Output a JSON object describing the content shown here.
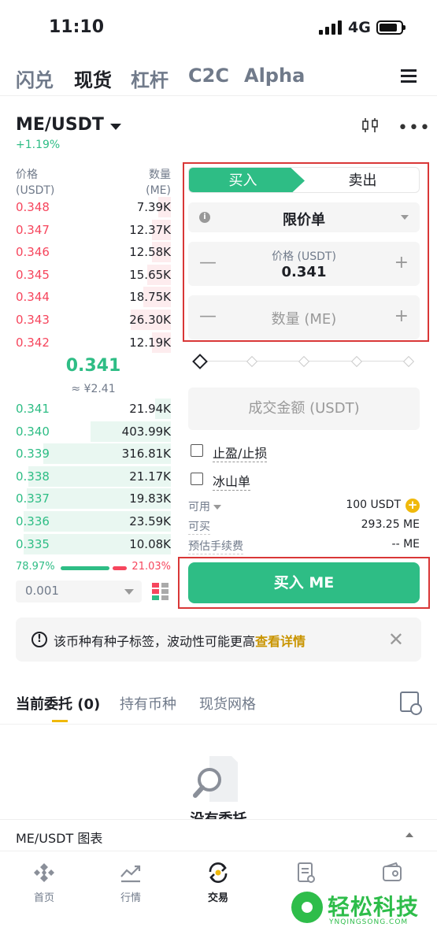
{
  "status": {
    "time": "11:10",
    "network": "4G"
  },
  "top_tabs": [
    "闪兑",
    "现货",
    "杠杆",
    "C2C",
    "Alpha"
  ],
  "pair": {
    "name": "ME/USDT",
    "change": "+1.19%"
  },
  "orderbook": {
    "price_header": "价格",
    "price_unit": "(USDT)",
    "amount_header": "数量",
    "amount_unit": "(ME)",
    "asks": [
      {
        "price": "0.348",
        "amount": "7.39K",
        "depth": 0.08
      },
      {
        "price": "0.347",
        "amount": "12.37K",
        "depth": 0.12
      },
      {
        "price": "0.346",
        "amount": "12.58K",
        "depth": 0.12
      },
      {
        "price": "0.345",
        "amount": "15.65K",
        "depth": 0.15
      },
      {
        "price": "0.344",
        "amount": "18.75K",
        "depth": 0.18
      },
      {
        "price": "0.343",
        "amount": "26.30K",
        "depth": 0.26
      },
      {
        "price": "0.342",
        "amount": "12.19K",
        "depth": 0.12
      }
    ],
    "mid_price": "0.341",
    "mid_fiat": "≈ ¥2.41",
    "bids": [
      {
        "price": "0.341",
        "amount": "21.94K",
        "depth": 0.1
      },
      {
        "price": "0.340",
        "amount": "403.99K",
        "depth": 0.52
      },
      {
        "price": "0.339",
        "amount": "316.81K",
        "depth": 0.82
      },
      {
        "price": "0.338",
        "amount": "21.17K",
        "depth": 0.92
      },
      {
        "price": "0.337",
        "amount": "19.83K",
        "depth": 0.93
      },
      {
        "price": "0.336",
        "amount": "23.59K",
        "depth": 0.95
      },
      {
        "price": "0.335",
        "amount": "10.08K",
        "depth": 0.95
      }
    ],
    "buy_ratio": "78.97%",
    "sell_ratio": "21.03%",
    "depth_value": "0.001"
  },
  "form": {
    "buy_tab": "买入",
    "sell_tab": "卖出",
    "order_type": "限价单",
    "price_label": "价格 (USDT)",
    "price_value": "0.341",
    "amount_placeholder": "数量 (ME)",
    "total_placeholder": "成交金额 (USDT)",
    "tp_sl": "止盈/止损",
    "iceberg": "冰山单",
    "available_label": "可用",
    "available_value": "100 USDT",
    "can_buy_label": "可买",
    "can_buy_value": "293.25 ME",
    "fee_label": "预估手续费",
    "fee_value": "-- ME",
    "submit": "买入 ME"
  },
  "notice": {
    "text": "该币种有种子标签，波动性可能更高",
    "link": "查看详情"
  },
  "bottom_tabs": [
    "当前委托 (0)",
    "持有币种",
    "现货网格"
  ],
  "empty_text": "没有委托",
  "chart_bar_label": "ME/USDT 图表",
  "nav": [
    "首页",
    "行情",
    "交易",
    "",
    ""
  ],
  "watermark": {
    "text": "轻松科技",
    "sub": "YNQINGSONG.COM"
  },
  "colors": {
    "green": "#2ebd85",
    "red": "#f6465d",
    "gold": "#f0b90b",
    "highlight_border": "#d93737"
  }
}
